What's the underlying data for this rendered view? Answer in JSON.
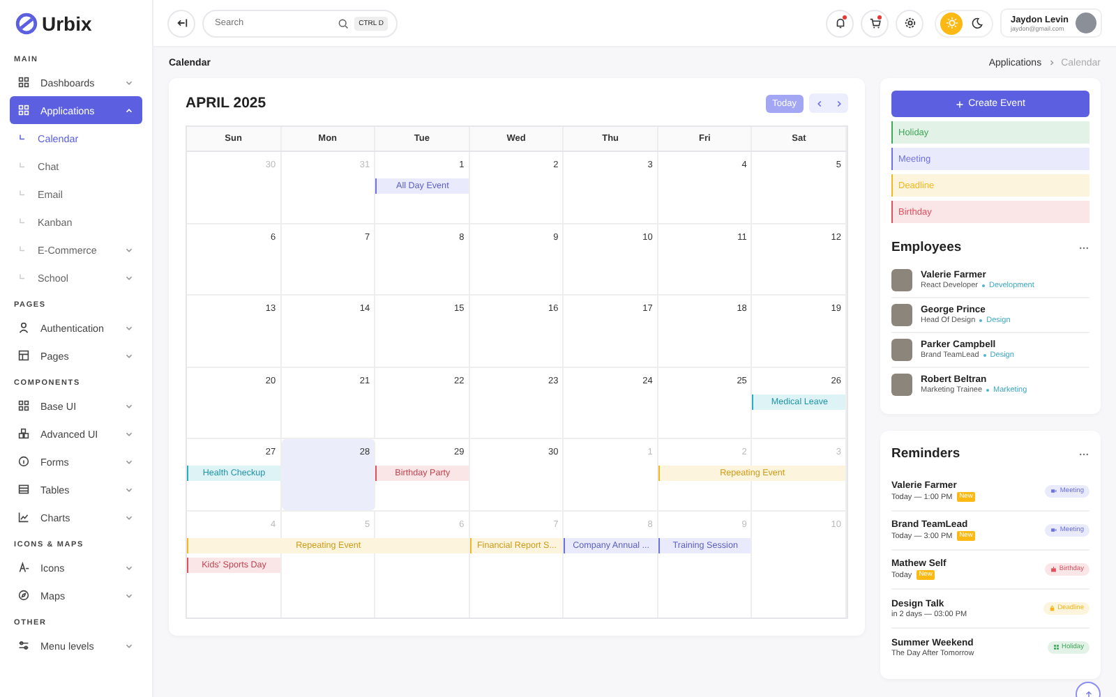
{
  "brand": {
    "name": "Urbix"
  },
  "sidebar": {
    "sections": [
      {
        "title": "MAIN",
        "items": [
          {
            "label": "Dashboards",
            "selected": false,
            "expanded": false
          },
          {
            "label": "Applications",
            "selected": true,
            "expanded": true,
            "children": [
              {
                "label": "Calendar",
                "selected": true
              },
              {
                "label": "Chat",
                "selected": false
              },
              {
                "label": "Email",
                "selected": false
              },
              {
                "label": "Kanban",
                "selected": false
              },
              {
                "label": "E-Commerce",
                "selected": false,
                "expanded": false
              },
              {
                "label": "School",
                "selected": false,
                "expanded": false
              }
            ]
          }
        ]
      },
      {
        "title": "PAGES",
        "items": [
          {
            "label": "Authentication",
            "selected": false,
            "expanded": false
          },
          {
            "label": "Pages",
            "selected": false,
            "expanded": false
          }
        ]
      },
      {
        "title": "COMPONENTS",
        "items": [
          {
            "label": "Base UI",
            "selected": false,
            "expanded": false
          },
          {
            "label": "Advanced UI",
            "selected": false,
            "expanded": false
          },
          {
            "label": "Forms",
            "selected": false,
            "expanded": false
          },
          {
            "label": "Tables",
            "selected": false,
            "expanded": false
          },
          {
            "label": "Charts",
            "selected": false,
            "expanded": false
          }
        ]
      },
      {
        "title": "ICONS & MAPS",
        "items": [
          {
            "label": "Icons",
            "selected": false,
            "expanded": false
          },
          {
            "label": "Maps",
            "selected": false,
            "expanded": false
          }
        ]
      },
      {
        "title": "OTHER",
        "items": [
          {
            "label": "Menu levels",
            "selected": false,
            "expanded": false
          }
        ]
      }
    ]
  },
  "topbar": {
    "search": {
      "placeholder": "Search",
      "shortcut": "CTRL D"
    },
    "tools": [
      {
        "kind": "bell",
        "dot": true
      },
      {
        "kind": "cart",
        "dot": true
      },
      {
        "kind": "gear",
        "dot": false
      }
    ],
    "theme": [
      {
        "kind": "light",
        "selected": true
      },
      {
        "kind": "dark",
        "selected": false
      }
    ],
    "user": {
      "name": "Jaydon Levin",
      "email": "jaydon@gmail.com"
    }
  },
  "page_title": "Calendar",
  "breadcrumb": [
    {
      "label": "Applications",
      "selected": false
    },
    {
      "label": "Calendar",
      "selected": true
    }
  ],
  "calendar": {
    "title": "APRIL 2025",
    "today_button": {
      "label": "Today",
      "selected": true
    },
    "weekdays": [
      "Sun",
      "Mon",
      "Tue",
      "Wed",
      "Thu",
      "Fri",
      "Sat"
    ],
    "weeks": [
      {
        "days": [
          {
            "n": "30",
            "muted": true,
            "today": false
          },
          {
            "n": "31",
            "muted": true,
            "today": false
          },
          {
            "n": "1",
            "muted": false,
            "today": false,
            "events": [
              {
                "title": "All Day Event",
                "color": "#6c70e6"
              }
            ]
          },
          {
            "n": "2",
            "muted": false,
            "today": false
          },
          {
            "n": "3",
            "muted": false,
            "today": false
          },
          {
            "n": "4",
            "muted": false,
            "today": false
          },
          {
            "n": "5",
            "muted": false,
            "today": false
          }
        ]
      },
      {
        "days": [
          {
            "n": "6",
            "muted": false,
            "today": false
          },
          {
            "n": "7",
            "muted": false,
            "today": false
          },
          {
            "n": "8",
            "muted": false,
            "today": false
          },
          {
            "n": "9",
            "muted": false,
            "today": false
          },
          {
            "n": "10",
            "muted": false,
            "today": false
          },
          {
            "n": "11",
            "muted": false,
            "today": false
          },
          {
            "n": "12",
            "muted": false,
            "today": false
          }
        ]
      },
      {
        "days": [
          {
            "n": "13",
            "muted": false,
            "today": false
          },
          {
            "n": "14",
            "muted": false,
            "today": false
          },
          {
            "n": "15",
            "muted": false,
            "today": false
          },
          {
            "n": "16",
            "muted": false,
            "today": false
          },
          {
            "n": "17",
            "muted": false,
            "today": false
          },
          {
            "n": "18",
            "muted": false,
            "today": false
          },
          {
            "n": "19",
            "muted": false,
            "today": false
          }
        ]
      },
      {
        "days": [
          {
            "n": "20",
            "muted": false,
            "today": false
          },
          {
            "n": "21",
            "muted": false,
            "today": false
          },
          {
            "n": "22",
            "muted": false,
            "today": false
          },
          {
            "n": "23",
            "muted": false,
            "today": false
          },
          {
            "n": "24",
            "muted": false,
            "today": false
          },
          {
            "n": "25",
            "muted": false,
            "today": false
          },
          {
            "n": "26",
            "muted": false,
            "today": false,
            "events": [
              {
                "title": "Medical Leave",
                "color": "#26aec4"
              }
            ]
          }
        ]
      },
      {
        "days": [
          {
            "n": "27",
            "muted": false,
            "today": false,
            "events": [
              {
                "title": "Health Checkup",
                "color": "#26aec4"
              }
            ]
          },
          {
            "n": "28",
            "muted": false,
            "today": true
          },
          {
            "n": "29",
            "muted": false,
            "today": false,
            "events": [
              {
                "title": "Birthday Party",
                "color": "#e0505f"
              }
            ]
          },
          {
            "n": "30",
            "muted": false,
            "today": false
          },
          {
            "n": "1",
            "muted": true,
            "today": false
          },
          {
            "n": "2",
            "muted": true,
            "today": false,
            "events": [
              {
                "title": "Repeating Event",
                "color": "#f2b71c"
              }
            ]
          },
          {
            "n": "3",
            "muted": true,
            "today": false,
            "continued": true
          }
        ]
      },
      {
        "days": [
          {
            "n": "4",
            "muted": true,
            "today": false,
            "events": [
              {
                "title": "Repeating Event",
                "color": "#f2b71c"
              },
              {
                "title": "Kids' Sports Day",
                "color": "#e0505f"
              }
            ]
          },
          {
            "n": "5",
            "muted": true,
            "today": false,
            "continued": true
          },
          {
            "n": "6",
            "muted": true,
            "today": false,
            "continued": true
          },
          {
            "n": "7",
            "muted": true,
            "today": false,
            "events": [
              {
                "title": "Financial Report S...",
                "color": "#f2b71c"
              }
            ]
          },
          {
            "n": "8",
            "muted": true,
            "today": false,
            "events": [
              {
                "title": "Company Annual ...",
                "color": "#6c70e6"
              }
            ]
          },
          {
            "n": "9",
            "muted": true,
            "today": false,
            "events": [
              {
                "title": "Training Session",
                "color": "#6c70e6"
              }
            ]
          },
          {
            "n": "10",
            "muted": true,
            "today": false
          }
        ]
      }
    ]
  },
  "create_button": "Create Event",
  "event_types": [
    {
      "label": "Holiday",
      "color": "#3fa85a"
    },
    {
      "label": "Meeting",
      "color": "#6c70e6"
    },
    {
      "label": "Deadline",
      "color": "#f2b71c"
    },
    {
      "label": "Birthday",
      "color": "#e0505f"
    }
  ],
  "employees": {
    "title": "Employees",
    "people": [
      {
        "name": "Valerie Farmer",
        "role": "React Developer",
        "dept": "Development"
      },
      {
        "name": "George Prince",
        "role": "Head Of Design",
        "dept": "Design"
      },
      {
        "name": "Parker Campbell",
        "role": "Brand TeamLead",
        "dept": "Design"
      },
      {
        "name": "Robert Beltran",
        "role": "Marketing Trainee",
        "dept": "Marketing"
      }
    ]
  },
  "reminders": {
    "title": "Reminders",
    "items": [
      {
        "title": "Valerie Farmer",
        "time": "Today — 1:00 PM",
        "badge": "New",
        "tag": {
          "kind": "meeting",
          "label": "Meeting",
          "color": "#6c70e6"
        }
      },
      {
        "title": "Brand TeamLead",
        "time": "Today — 3:00 PM",
        "badge": "New",
        "tag": {
          "kind": "meeting",
          "label": "Meeting",
          "color": "#6c70e6"
        }
      },
      {
        "title": "Mathew Self",
        "time": "Today",
        "badge": "New",
        "tag": {
          "kind": "birthday",
          "label": "Birthday",
          "color": "#e0505f"
        }
      },
      {
        "title": "Design Talk",
        "time": "in 2 days — 03:00 PM",
        "tag": {
          "kind": "deadline",
          "label": "Deadline",
          "color": "#f2b71c"
        }
      },
      {
        "title": "Summer Weekend",
        "time": "The Day After Tomorrow",
        "tag": {
          "kind": "holiday",
          "label": "Holiday",
          "color": "#3fa85a"
        }
      }
    ]
  }
}
